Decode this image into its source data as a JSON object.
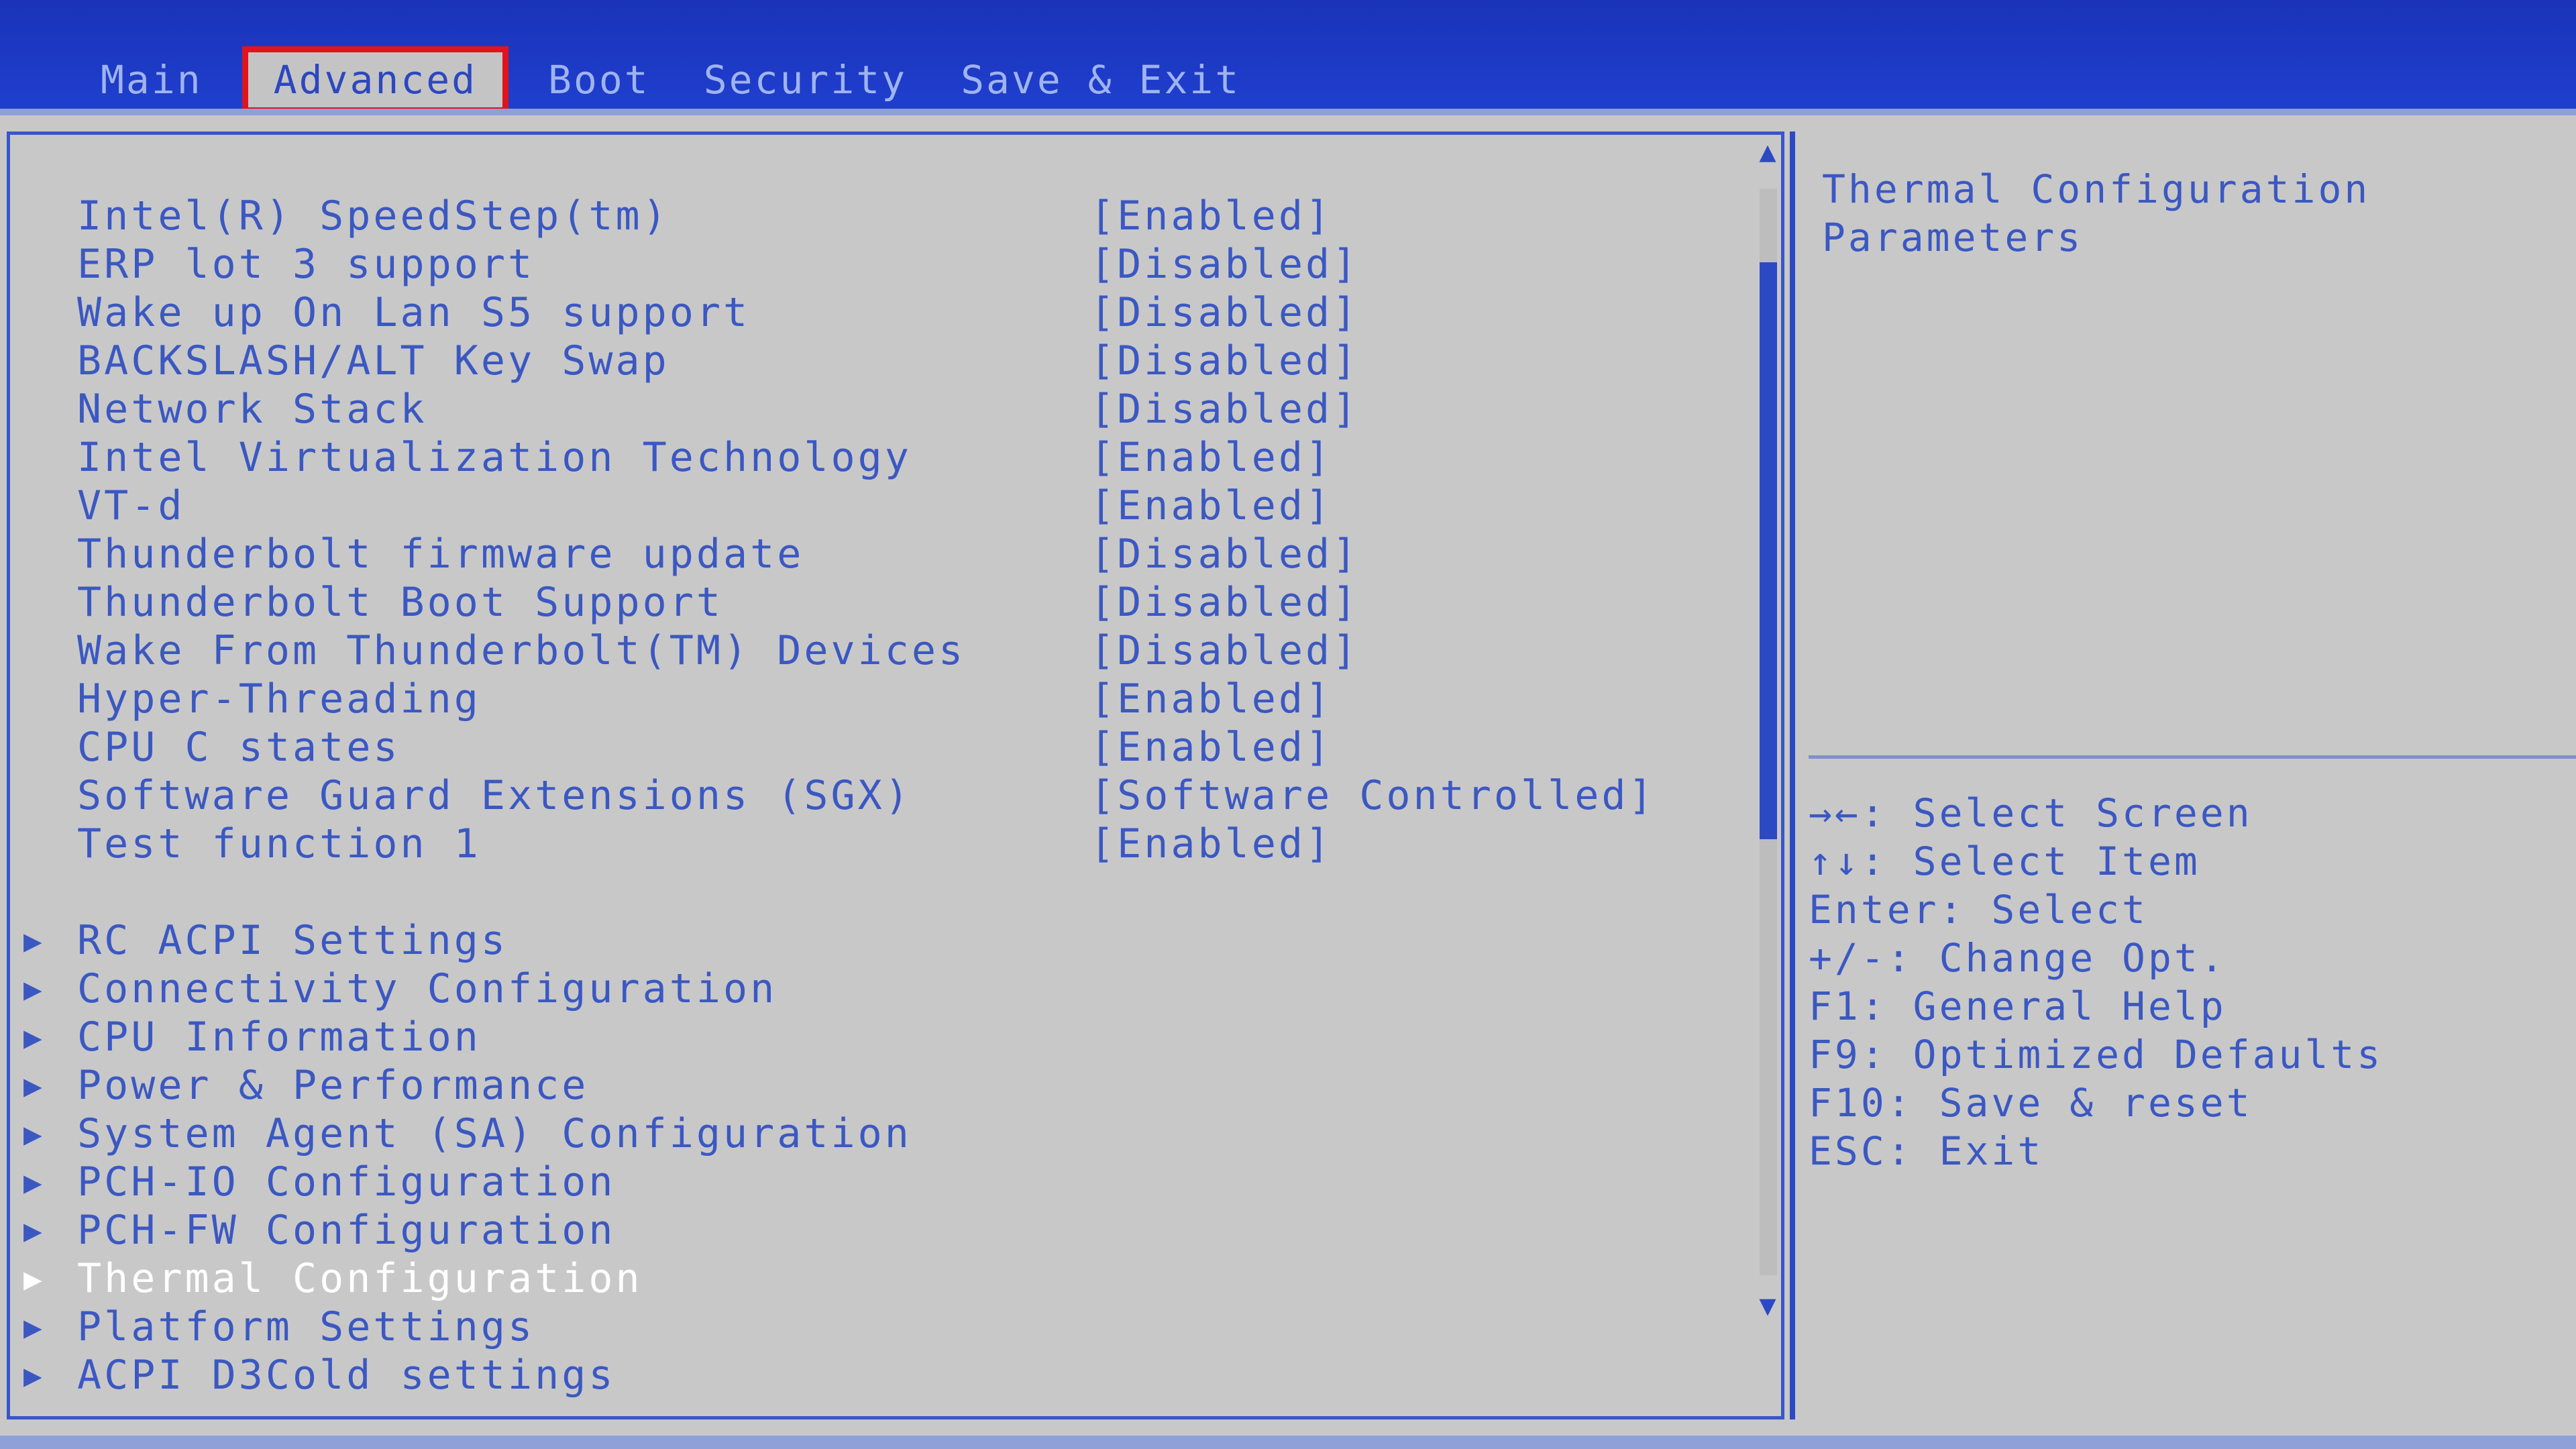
{
  "tabs": [
    {
      "label": "Main",
      "active": false
    },
    {
      "label": "Advanced",
      "active": true
    },
    {
      "label": "Boot",
      "active": false
    },
    {
      "label": "Security",
      "active": false
    },
    {
      "label": "Save & Exit",
      "active": false
    }
  ],
  "settings": [
    {
      "label": "Intel(R) SpeedStep(tm)",
      "value": "[Enabled]"
    },
    {
      "label": "ERP lot 3 support",
      "value": "[Disabled]"
    },
    {
      "label": "Wake up On Lan S5 support",
      "value": "[Disabled]"
    },
    {
      "label": "BACKSLASH/ALT Key Swap",
      "value": "[Disabled]"
    },
    {
      "label": "Network Stack",
      "value": "[Disabled]"
    },
    {
      "label": "Intel Virtualization Technology",
      "value": "[Enabled]"
    },
    {
      "label": "VT-d",
      "value": "[Enabled]"
    },
    {
      "label": "Thunderbolt firmware update",
      "value": "[Disabled]"
    },
    {
      "label": "Thunderbolt Boot Support",
      "value": "[Disabled]"
    },
    {
      "label": "Wake From Thunderbolt(TM) Devices",
      "value": "[Disabled]"
    },
    {
      "label": "Hyper-Threading",
      "value": "[Enabled]"
    },
    {
      "label": "CPU C states",
      "value": "[Enabled]"
    },
    {
      "label": "Software Guard Extensions (SGX)",
      "value": "[Software Controlled]"
    },
    {
      "label": "Test function 1",
      "value": "[Enabled]"
    }
  ],
  "submenus": [
    {
      "label": "RC ACPI Settings",
      "selected": false
    },
    {
      "label": "Connectivity Configuration",
      "selected": false
    },
    {
      "label": "CPU Information",
      "selected": false
    },
    {
      "label": "Power & Performance",
      "selected": false
    },
    {
      "label": "System Agent (SA) Configuration",
      "selected": false
    },
    {
      "label": "PCH-IO Configuration",
      "selected": false
    },
    {
      "label": "PCH-FW Configuration",
      "selected": false
    },
    {
      "label": "Thermal Configuration",
      "selected": true
    },
    {
      "label": "Platform Settings",
      "selected": false
    },
    {
      "label": "ACPI D3Cold settings",
      "selected": false
    }
  ],
  "submenu_arrow": "▶",
  "scroll": {
    "up": "▲",
    "down": "▼"
  },
  "help": {
    "description": [
      "Thermal Configuration",
      "Parameters"
    ],
    "keys": [
      "→←: Select Screen",
      "↑↓: Select Item",
      "Enter: Select",
      "+/-: Change Opt.",
      "F1: General Help",
      "F9: Optimized Defaults",
      "F10: Save & reset",
      "ESC: Exit"
    ]
  },
  "colors": {
    "header_blue": "#1f3fce",
    "text_blue": "#3b58c2",
    "background_gray": "#c4c4c4",
    "highlight_red": "#e0141c",
    "selected_white": "#ffffff"
  }
}
